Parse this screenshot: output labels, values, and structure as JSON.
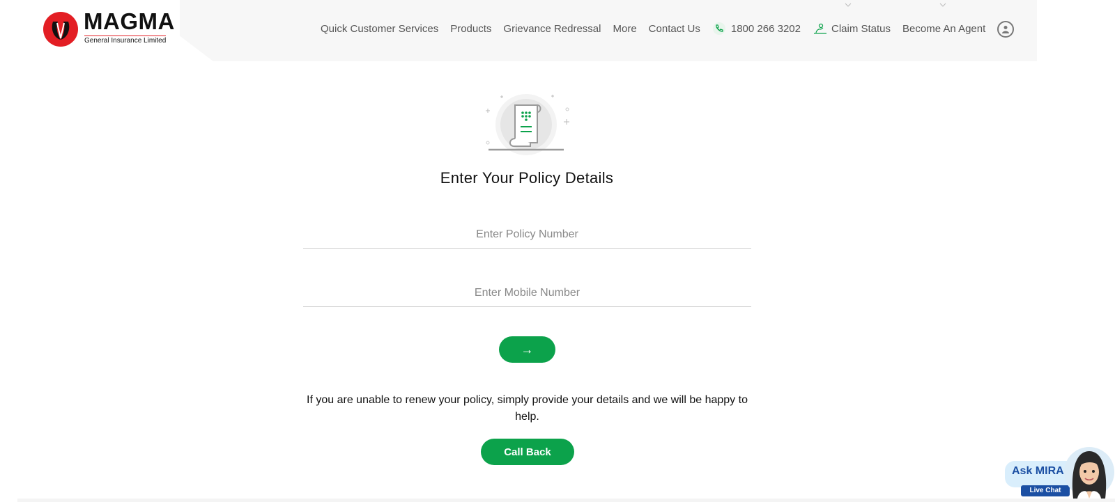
{
  "brand": {
    "name": "MAGMA",
    "subtitle": "General Insurance Limited"
  },
  "nav": {
    "items": [
      {
        "label": "Quick Customer Services"
      },
      {
        "label": "Products"
      },
      {
        "label": "Grievance Redressal"
      },
      {
        "label": "More"
      },
      {
        "label": "Contact Us"
      },
      {
        "label": "1800 266 3202",
        "icon": "phone-icon"
      },
      {
        "label": "Claim Status",
        "icon": "claim-icon"
      },
      {
        "label": "Become An Agent"
      }
    ]
  },
  "form": {
    "title": "Enter Your Policy Details",
    "policy_placeholder": "Enter Policy Number",
    "mobile_placeholder": "Enter Mobile Number",
    "submit_icon": "→",
    "help_text": "If you are unable to renew your policy, simply provide your details and we will be happy to help.",
    "callback_label": "Call Back"
  },
  "chat": {
    "title": "Ask MIRA",
    "tag": "Live Chat"
  },
  "colors": {
    "accent_green": "#0ca24b",
    "brand_red": "#e31e24",
    "chat_blue": "#1b4fa3"
  }
}
